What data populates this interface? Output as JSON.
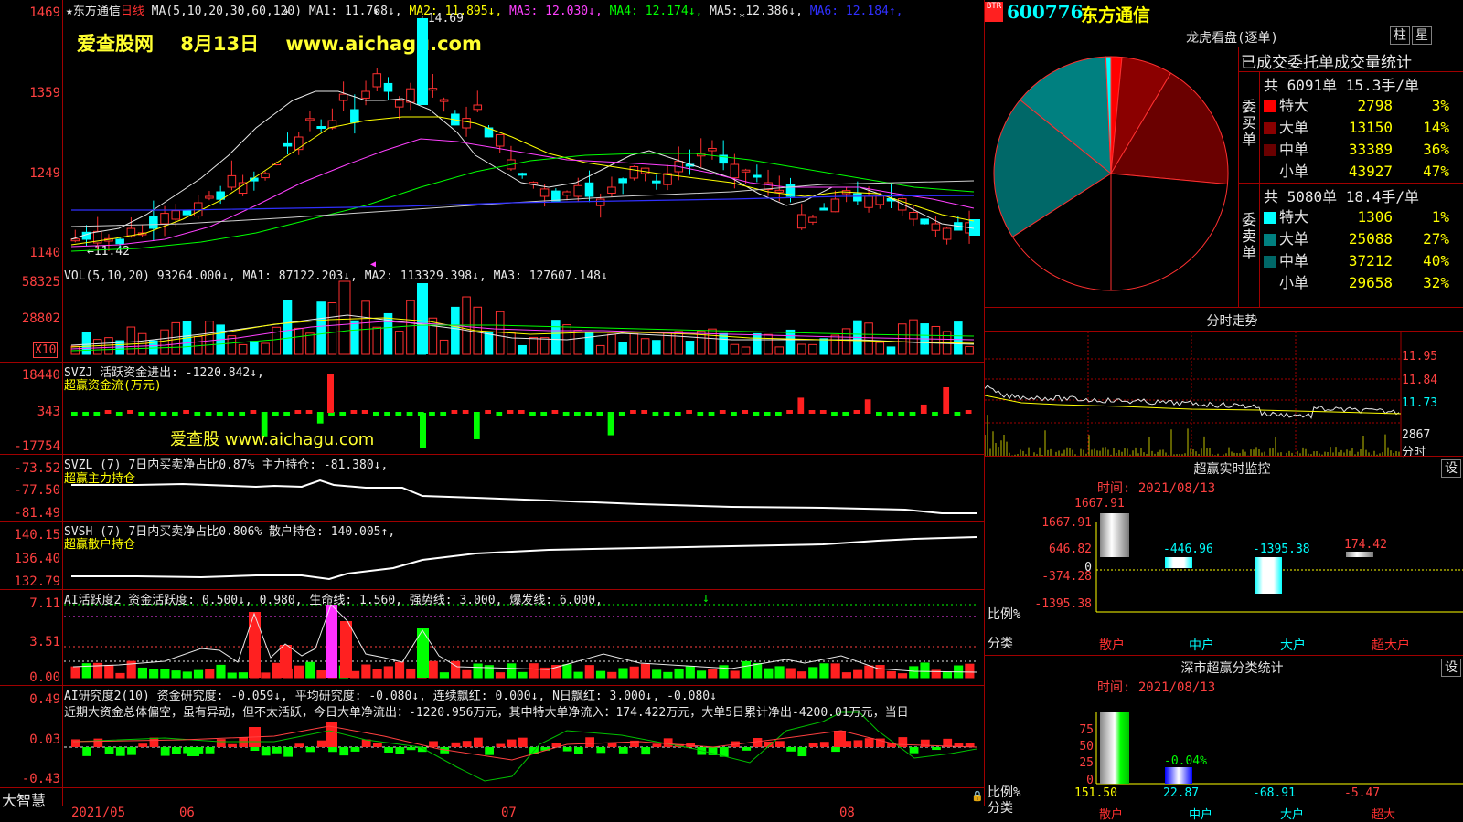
{
  "watermark": {
    "line1": "爱查股网",
    "date": "8月13日",
    "url": "www.aichagu.com",
    "sub": "爱查股 www.aichagu.com"
  },
  "main": {
    "header": {
      "stock": "★东方通信",
      "period": "日线",
      "ma_prefix": "MA(5,10,20,30,60,120)",
      "ma": [
        {
          "t": "MA1: 11.768↓",
          "c": "#e8e8e8"
        },
        {
          "t": "MA2: 11.895↓",
          "c": "#ffff00"
        },
        {
          "t": "MA3: 12.030↓",
          "c": "#ff40ff"
        },
        {
          "t": "MA4: 12.174↓",
          "c": "#00ff00"
        },
        {
          "t": "MA5: 12.386↓",
          "c": "#e8e8e8"
        },
        {
          "t": "MA6: 12.184↑",
          "c": "#3030ff"
        }
      ]
    },
    "yticks": [
      "1469",
      "1359",
      "1249",
      "1140"
    ],
    "hi_label": "14.69",
    "lo_label": "11.42"
  },
  "vol": {
    "header": "VOL(5,10,20) 93264.000↓, MA1: 87122.203↓, MA2: 113329.398↓, MA3: 127607.148↓",
    "yticks": [
      "58325",
      "28802"
    ],
    "unit": "X10"
  },
  "svzj": {
    "header": "SVZJ  活跃资金进出: -1220.842↓,",
    "sub": "超赢资金流(万元)",
    "yticks": [
      "18440",
      "343",
      "-17754"
    ]
  },
  "svzl": {
    "header": "SVZL (7) 7日内买卖净占比0.87% 主力持仓: -81.380↓,",
    "sub": "超赢主力持仓",
    "yticks": [
      "-73.52",
      "-77.50",
      "-81.49"
    ]
  },
  "svsh": {
    "header": "SVSH (7) 7日内买卖净占比0.806% 散户持仓: 140.005↑,",
    "sub": "超赢散户持仓",
    "yticks": [
      "140.15",
      "136.40",
      "132.79"
    ]
  },
  "ai2": {
    "header": "AI活跃度2 资金活跃度: 0.500↓, 0.980, 生命线: 1.560, 强势线: 3.000, 爆发线: 6.000,",
    "yticks": [
      "7.11",
      "3.51",
      "0.00"
    ]
  },
  "ai3": {
    "header": "AI研究度2(10) 资金研究度: -0.059↓, 平均研究度: -0.080↓, 连续飘红: 0.000↓, N日飘红: 3.000↓, -0.080↓",
    "comment": "近期大资金总体偏空，虽有异动，但不太活跃，今日大单净流出：-1220.956万元，其中特大单净流入：174.422万元，大单5日累计净出-4200.01万元，当日",
    "yticks": [
      "0.49",
      "0.03",
      "-0.43"
    ]
  },
  "xaxis": {
    "left_label": "大智慧",
    "labels": [
      "2021/05",
      "06",
      "07",
      "08"
    ]
  },
  "side": {
    "code": "600776",
    "name": "东方通信",
    "logo": "BTR",
    "lhb_title": "龙虎看盘(逐单)",
    "btn_zhu": "柱",
    "btn_star": "星",
    "stat_title": "已成交委托单成交量统计",
    "buy": {
      "label": "委买单",
      "summary": "共 6091单 15.3手/单",
      "rows": [
        {
          "n": "特大",
          "v": "2798",
          "p": "3%",
          "c": "#ff0000"
        },
        {
          "n": "大单",
          "v": "13150",
          "p": "14%",
          "c": "#8b0000"
        },
        {
          "n": "中单",
          "v": "33389",
          "p": "36%",
          "c": "#6a0000"
        },
        {
          "n": "小单",
          "v": "43927",
          "p": "47%",
          "c": "#000000"
        }
      ]
    },
    "sell": {
      "label": "委卖单",
      "summary": "共 5080单 18.4手/单",
      "rows": [
        {
          "n": "特大",
          "v": "1306",
          "p": "1%",
          "c": "#00ffff"
        },
        {
          "n": "大单",
          "v": "25088",
          "p": "27%",
          "c": "#008080"
        },
        {
          "n": "中单",
          "v": "37212",
          "p": "40%",
          "c": "#006868"
        },
        {
          "n": "小单",
          "v": "29658",
          "p": "32%",
          "c": "#000000"
        }
      ]
    },
    "fs_title": "分时走势",
    "fs_prices": [
      "11.95",
      "11.84",
      "11.73"
    ],
    "fs_vol": "2867",
    "fs_unit": "分时",
    "mon_title": "超赢实时监控",
    "btn_set": "设",
    "mon_time": "时间: 2021/08/13",
    "mon_y": [
      "1667.91",
      "646.82",
      "0",
      "-374.28",
      "-1395.38"
    ],
    "mon_vals": [
      "1667.91",
      "-446.96",
      "-1395.38",
      "174.42"
    ],
    "mon_ratio": "比例%",
    "mon_cat_label": "分类",
    "cats": [
      "散户",
      "中户",
      "大户",
      "超大户"
    ],
    "sz_title": "深市超赢分类统计",
    "sz_time": "时间: 2021/08/13",
    "sz_y": [
      "75",
      "50",
      "25",
      "0"
    ],
    "sz_pct": "-0.04%",
    "sz_vals": [
      "151.50",
      "22.87",
      "-68.91",
      "-5.47"
    ],
    "sz_cats": [
      "散户",
      "中户",
      "大户",
      "超大"
    ]
  }
}
